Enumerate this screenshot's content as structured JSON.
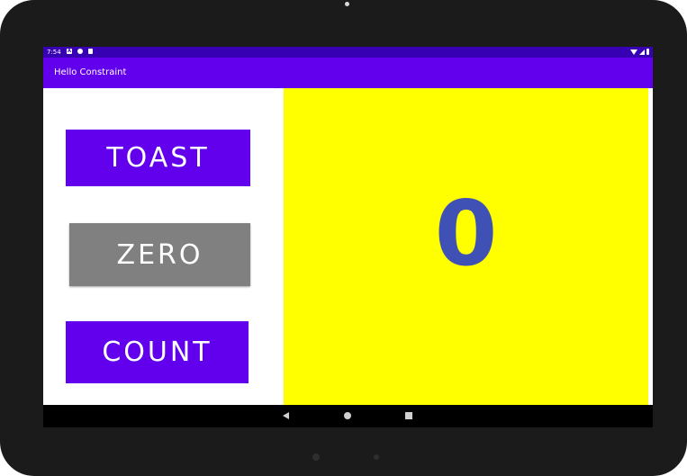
{
  "status_bar": {
    "time": "7:54",
    "notification_icons": [
      "android-system-icon",
      "file-icon",
      "sd-card-icon"
    ],
    "system_icons": [
      "wifi-icon",
      "signal-icon",
      "battery-icon"
    ]
  },
  "app_bar": {
    "title": "Hello Constraint"
  },
  "main": {
    "toast_label": "TOAST",
    "zero_label": "ZERO",
    "count_label": "COUNT",
    "count_value": "0"
  },
  "nav_bar": {
    "icons": [
      "back-icon",
      "home-icon",
      "recents-icon"
    ]
  },
  "colors": {
    "status_bar": "#3700b3",
    "app_bar": "#6200ee",
    "primary_button": "#6200ee",
    "zero_button": "#808080",
    "count_panel": "#ffff00",
    "count_text": "#3f51b5"
  }
}
